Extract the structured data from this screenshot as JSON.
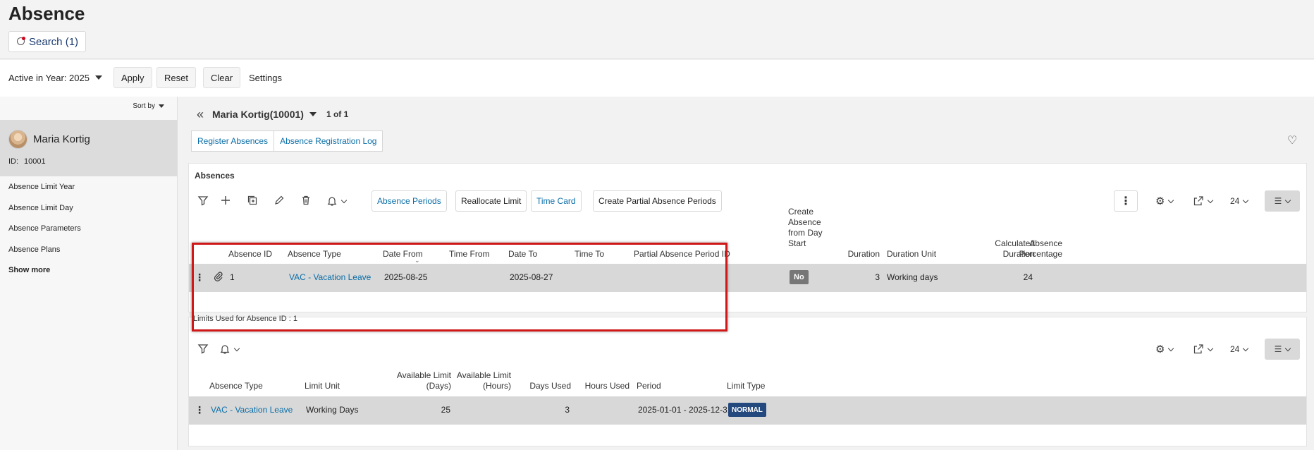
{
  "header": {
    "title": "Absence",
    "search_label": "Search (1)"
  },
  "filterbar": {
    "active_year_label": "Active in Year: 2025",
    "apply_label": "Apply",
    "reset_label": "Reset",
    "clear_label": "Clear",
    "settings_label": "Settings"
  },
  "sidebar": {
    "sort_label": "Sort by",
    "person": {
      "name": "Maria Kortig",
      "id_label": "ID:",
      "id": "10001"
    },
    "links": [
      "Absence Limit Year",
      "Absence Limit Day",
      "Absence Parameters",
      "Absence Plans"
    ],
    "show_more": "Show more"
  },
  "record_nav": {
    "name": "Maria Kortig(10001)",
    "count": "1 of 1"
  },
  "tabs": [
    "Register Absences",
    "Absence Registration Log"
  ],
  "absences": {
    "title": "Absences",
    "buttons": {
      "periods": "Absence Periods",
      "reallocate": "Reallocate Limit",
      "time_card": "Time Card",
      "partial": "Create Partial Absence Periods"
    },
    "page_size": "24",
    "columns": {
      "absence_id": "Absence ID",
      "absence_type": "Absence Type",
      "date_from": "Date From",
      "time_from": "Time From",
      "date_to": "Date To",
      "time_to": "Time To",
      "partial_id": "Partial Absence Period ID",
      "percentage_l1": "Absence",
      "percentage_l2": "Percentage",
      "create_l1": "Create",
      "create_l2": "Absence",
      "create_l3": "from Day",
      "create_l4": "Start",
      "duration": "Duration",
      "duration_unit": "Duration Unit",
      "calc_l1": "Calculated",
      "calc_l2": "Duration"
    },
    "row": {
      "absence_id": "1",
      "absence_type": "VAC - Vacation Leave",
      "date_from": "2025-08-25",
      "date_to": "2025-08-27",
      "create_from_day_start": "No",
      "duration": "3",
      "duration_unit": "Working days",
      "calculated_duration": "24"
    }
  },
  "limits": {
    "title": "Limits Used for Absence ID : 1",
    "page_size": "24",
    "columns": {
      "absence_type": "Absence Type",
      "limit_unit": "Limit Unit",
      "avail_days_l1": "Available Limit",
      "avail_days_l2": "(Days)",
      "avail_hours_l1": "Available Limit",
      "avail_hours_l2": "(Hours)",
      "days_used": "Days Used",
      "hours_used": "Hours Used",
      "period": "Period",
      "limit_type": "Limit Type"
    },
    "row": {
      "absence_type": "VAC - Vacation Leave",
      "limit_unit": "Working Days",
      "available_days": "25",
      "days_used": "3",
      "period": "2025-01-01 - 2025-12-31",
      "limit_type": "NORMAL"
    }
  },
  "colors": {
    "link": "#0a6ea8",
    "highlight": "#d01818",
    "badge_normal": "#24497e",
    "badge_no": "#777777"
  }
}
